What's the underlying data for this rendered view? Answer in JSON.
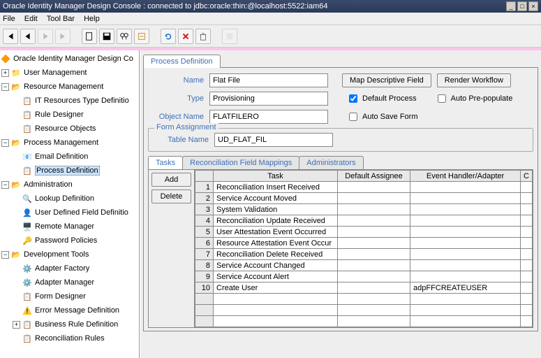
{
  "window": {
    "title": "Oracle Identity Manager Design Console : connected to jdbc:oracle:thin:@localhost:5522:iam64"
  },
  "menu": {
    "file": "File",
    "edit": "Edit",
    "toolbar": "Tool Bar",
    "help": "Help"
  },
  "tree": {
    "root": "Oracle Identity Manager Design Co",
    "user_mgmt": "User Management",
    "resource_mgmt": "Resource Management",
    "it_res_type": "IT Resources Type Definitio",
    "rule_designer": "Rule Designer",
    "resource_objects": "Resource Objects",
    "process_mgmt": "Process Management",
    "email_def": "Email Definition",
    "process_def": "Process Definition",
    "administration": "Administration",
    "lookup_def": "Lookup Definition",
    "user_field_def": "User Defined Field Definitio",
    "remote_mgr": "Remote Manager",
    "pwd_policies": "Password Policies",
    "dev_tools": "Development Tools",
    "adapter_factory": "Adapter Factory",
    "adapter_mgr": "Adapter Manager",
    "form_designer": "Form Designer",
    "error_msg_def": "Error Message Definition",
    "biz_rule_def": "Business Rule Definition",
    "recon_rules": "Reconciliation Rules"
  },
  "form": {
    "tab_title": "Process Definition",
    "name_label": "Name",
    "name_value": "Flat File",
    "type_label": "Type",
    "type_value": "Provisioning",
    "object_name_label": "Object Name",
    "object_name_value": "FLATFILERO",
    "map_btn": "Map Descriptive Field",
    "render_btn": "Render Workflow",
    "default_process": "Default Process",
    "auto_prepopulate": "Auto Pre-populate",
    "auto_save": "Auto Save Form",
    "form_assignment": "Form Assignment",
    "table_name_label": "Table Name",
    "table_name_value": "UD_FLAT_FIL"
  },
  "subtabs": {
    "tasks": "Tasks",
    "recon": "Reconciliation Field Mappings",
    "admins": "Administrators"
  },
  "task_btns": {
    "add": "Add",
    "delete": "Delete"
  },
  "task_headers": {
    "blank": "",
    "task": "Task",
    "assignee": "Default Assignee",
    "handler": "Event Handler/Adapter",
    "c": "C"
  },
  "tasks": [
    {
      "n": "1",
      "name": "Reconciliation Insert Received",
      "a": "",
      "h": ""
    },
    {
      "n": "2",
      "name": "Service Account Moved",
      "a": "",
      "h": ""
    },
    {
      "n": "3",
      "name": "System Validation",
      "a": "",
      "h": ""
    },
    {
      "n": "4",
      "name": "Reconciliation Update Received",
      "a": "",
      "h": ""
    },
    {
      "n": "5",
      "name": "User Attestation Event Occurred",
      "a": "",
      "h": ""
    },
    {
      "n": "6",
      "name": "Resource Attestation Event Occur",
      "a": "",
      "h": ""
    },
    {
      "n": "7",
      "name": "Reconciliation Delete Received",
      "a": "",
      "h": ""
    },
    {
      "n": "8",
      "name": "Service Account Changed",
      "a": "",
      "h": ""
    },
    {
      "n": "9",
      "name": "Service Account Alert",
      "a": "",
      "h": ""
    },
    {
      "n": "10",
      "name": "Create User",
      "a": "",
      "h": "adpFFCREATEUSER"
    }
  ]
}
